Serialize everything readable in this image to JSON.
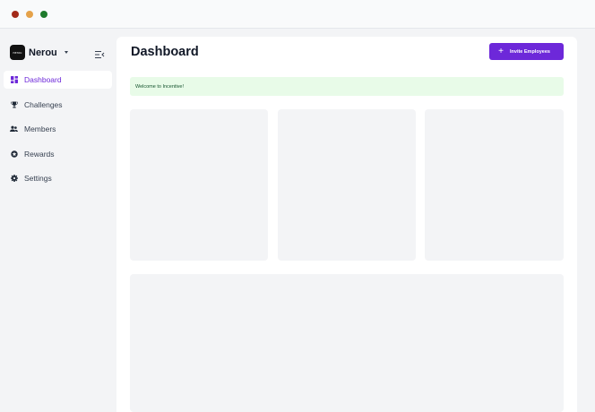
{
  "window": {
    "controls": [
      "close",
      "minimize",
      "maximize"
    ],
    "colors": {
      "close": "#a32a1a",
      "minimize": "#e5a24a",
      "maximize": "#1e7a2c"
    }
  },
  "brand": {
    "logo_text": "nerou",
    "name": "Nerou"
  },
  "sidebar": {
    "items": [
      {
        "label": "Dashboard",
        "icon": "grid-icon",
        "active": true
      },
      {
        "label": "Challenges",
        "icon": "trophy-icon",
        "active": false
      },
      {
        "label": "Members",
        "icon": "users-icon",
        "active": false
      },
      {
        "label": "Rewards",
        "icon": "star-icon",
        "active": false
      },
      {
        "label": "Settings",
        "icon": "gear-icon",
        "active": false
      }
    ]
  },
  "header": {
    "title": "Dashboard",
    "invite_button": "Invite Employees"
  },
  "alert": {
    "message": "Welcome to Incentive!"
  },
  "colors": {
    "accent": "#6d28d9",
    "success_bg": "#e8fbe8",
    "placeholder": "#f3f4f6"
  }
}
